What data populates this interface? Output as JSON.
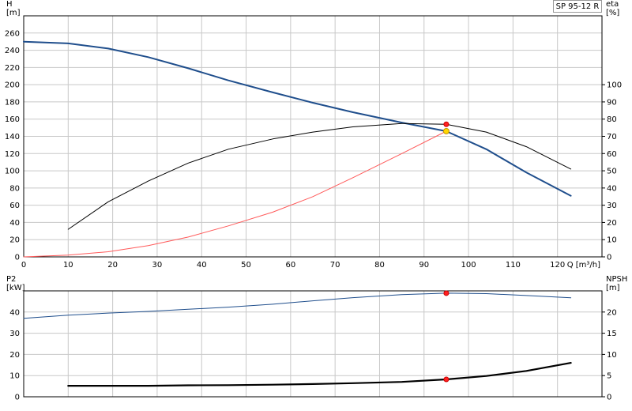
{
  "pump_label": "SP 95-12 R",
  "chart_data": [
    {
      "id": "top",
      "type": "line",
      "x_label": "Q [m³/h]",
      "xlim": [
        0,
        130
      ],
      "x_ticks": [
        0,
        10,
        20,
        30,
        40,
        50,
        60,
        70,
        80,
        90,
        100,
        110,
        120
      ],
      "left_axis": {
        "label_top": "H",
        "label_unit": "[m]",
        "ylim": [
          0,
          280
        ],
        "ticks": [
          0,
          20,
          40,
          60,
          80,
          100,
          120,
          140,
          160,
          180,
          200,
          220,
          240,
          260
        ]
      },
      "right_axis": {
        "label_top": "eta",
        "label_unit": "[%]",
        "ylim": [
          0,
          140
        ],
        "ticks": [
          0,
          10,
          20,
          30,
          40,
          50,
          60,
          70,
          80,
          90,
          100
        ]
      },
      "grid": true,
      "series": [
        {
          "axis": "left",
          "color": "#1f4e8c",
          "width": 2,
          "x": [
            0,
            10,
            19,
            28,
            37,
            46,
            56,
            65,
            74,
            85,
            95,
            104,
            113,
            123
          ],
          "y": [
            250,
            248,
            242,
            232,
            219,
            205,
            191,
            179,
            168,
            156,
            146,
            125,
            98,
            71
          ]
        },
        {
          "axis": "right",
          "color": "#000000",
          "width": 1,
          "x": [
            10,
            19,
            28,
            37,
            46,
            56,
            65,
            74,
            85,
            95,
            104,
            113,
            123
          ],
          "y": [
            16,
            32,
            44,
            54.5,
            62.5,
            68.5,
            72.5,
            75.5,
            77.5,
            77,
            72.5,
            64,
            51
          ]
        },
        {
          "axis": "left",
          "color": "#ff5a5a",
          "width": 1,
          "x": [
            0,
            10,
            19,
            28,
            37,
            46,
            56,
            65,
            74,
            85,
            95
          ],
          "y": [
            0,
            2,
            6,
            13,
            23,
            36,
            52,
            70,
            92,
            120,
            146
          ]
        }
      ],
      "markers": [
        {
          "axis": "right",
          "x": 95,
          "y": 77,
          "fill": "#ff2020",
          "stroke": "#cc0000",
          "r": 3
        },
        {
          "axis": "left",
          "x": 95,
          "y": 146,
          "fill": "#ffd700",
          "stroke": "#c09000",
          "r": 3.5
        }
      ]
    },
    {
      "id": "bottom",
      "type": "line",
      "xlim": [
        0,
        130
      ],
      "x_ticks": [
        0,
        10,
        20,
        30,
        40,
        50,
        60,
        70,
        80,
        90,
        100,
        110,
        120
      ],
      "left_axis": {
        "label_top": "P2",
        "label_unit": "[kW]",
        "ylim": [
          0,
          50
        ],
        "ticks": [
          0,
          10,
          20,
          30,
          40
        ]
      },
      "right_axis": {
        "label_top": "NPSH",
        "label_unit": "[m]",
        "ylim": [
          0,
          25
        ],
        "ticks": [
          0,
          5,
          10,
          15,
          20
        ]
      },
      "grid": true,
      "series": [
        {
          "axis": "left",
          "color": "#1f4e8c",
          "width": 1,
          "x": [
            0,
            10,
            19,
            28,
            37,
            46,
            56,
            65,
            74,
            85,
            95,
            104,
            113,
            123
          ],
          "y": [
            37,
            38.5,
            39.5,
            40.3,
            41.3,
            42.3,
            43.7,
            45.3,
            46.8,
            48.2,
            48.9,
            48.7,
            47.8,
            46.7
          ]
        },
        {
          "axis": "right",
          "color": "#000000",
          "width": 2.2,
          "x": [
            10,
            19,
            28,
            37,
            46,
            56,
            65,
            74,
            85,
            95,
            104,
            113,
            123
          ],
          "y": [
            2.6,
            2.6,
            2.6,
            2.7,
            2.75,
            2.85,
            3,
            3.2,
            3.5,
            4.1,
            4.9,
            6.1,
            8
          ]
        }
      ],
      "markers": [
        {
          "axis": "left",
          "x": 95,
          "y": 48.9,
          "fill": "#ff2020",
          "stroke": "#cc0000",
          "r": 3
        },
        {
          "axis": "right",
          "x": 95,
          "y": 4.1,
          "fill": "#ff2020",
          "stroke": "#cc0000",
          "r": 3
        }
      ]
    }
  ]
}
